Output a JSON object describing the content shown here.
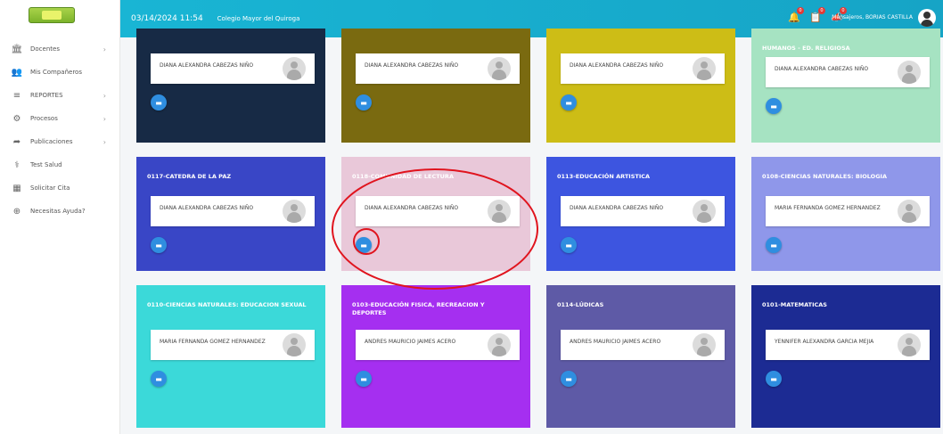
{
  "header": {
    "datetime": "03/14/2024 11:54",
    "school": "Colegio Mayor del Quiroga",
    "user_name": "Mensajeros, BORIAS CASTILLA",
    "notifications": [
      {
        "icon": "bell-icon",
        "count": "0"
      },
      {
        "icon": "clipboard-icon",
        "count": "0"
      },
      {
        "icon": "megaphone-icon",
        "count": "0"
      }
    ]
  },
  "sidebar": {
    "items": [
      {
        "label": "Docentes",
        "icon": "building-icon",
        "has_arrow": true
      },
      {
        "label": "Mis Compañeros",
        "icon": "users-icon",
        "has_arrow": false
      },
      {
        "label": "REPORTES",
        "icon": "reports-icon",
        "has_arrow": true
      },
      {
        "label": "Procesos",
        "icon": "process-icon",
        "has_arrow": true
      },
      {
        "label": "Publicaciones",
        "icon": "share-icon",
        "has_arrow": true
      },
      {
        "label": "Test Salud",
        "icon": "health-icon",
        "has_arrow": false
      },
      {
        "label": "Solicitar Cita",
        "icon": "calendar-icon",
        "has_arrow": false
      },
      {
        "label": "Necesitas Ayuda?",
        "icon": "help-icon",
        "has_arrow": false
      }
    ]
  },
  "cards": [
    {
      "title": "",
      "teacher": "DIANA ALEXANDRA CABEZAS NIÑO",
      "color": "#172a45"
    },
    {
      "title": "",
      "teacher": "DIANA ALEXANDRA CABEZAS NIÑO",
      "color": "#7a6a10"
    },
    {
      "title": "",
      "teacher": "DIANA ALEXANDRA CABEZAS NIÑO",
      "color": "#cdbd16"
    },
    {
      "title": "HUMANOS - ED. RELIGIOSA",
      "teacher": "DIANA ALEXANDRA CABEZAS NIÑO",
      "color": "#a6e3c2"
    },
    {
      "title": "0117-CATEDRA DE LA PAZ",
      "teacher": "DIANA ALEXANDRA CABEZAS NIÑO",
      "color": "#3946c6"
    },
    {
      "title": "0118-Comunidad de Lectura",
      "teacher": "DIANA ALEXANDRA CABEZAS NIÑO",
      "color": "#e9c8d9"
    },
    {
      "title": "0113-EDUCACIÓN ARTISTICA",
      "teacher": "DIANA ALEXANDRA CABEZAS NIÑO",
      "color": "#3d55e0"
    },
    {
      "title": "0108-CIENCIAS NATURALES: BIOLOGIA",
      "teacher": "MARIA FERNANDA GOMEZ HERNANDEZ",
      "color": "#8f97ea"
    },
    {
      "title": "0110-CIENCIAS NATURALES: EDUCACION SEXUAL",
      "teacher": "MARIA FERNANDA GOMEZ HERNANDEZ",
      "color": "#3bd9d9"
    },
    {
      "title": "0103-EDUCACIÓN FISICA, RECREACION Y DEPORTES",
      "teacher": "ANDRES MAURICIO JAIMES ACERO",
      "color": "#a52ff0"
    },
    {
      "title": "0114-LÚDICAS",
      "teacher": "ANDRES MAURICIO JAIMES ACERO",
      "color": "#5e5aa6"
    },
    {
      "title": "0101-MATEMATICAS",
      "teacher": "YENNIFER ALEXANDRA GARCIA MEJIA",
      "color": "#1c2b93"
    }
  ]
}
